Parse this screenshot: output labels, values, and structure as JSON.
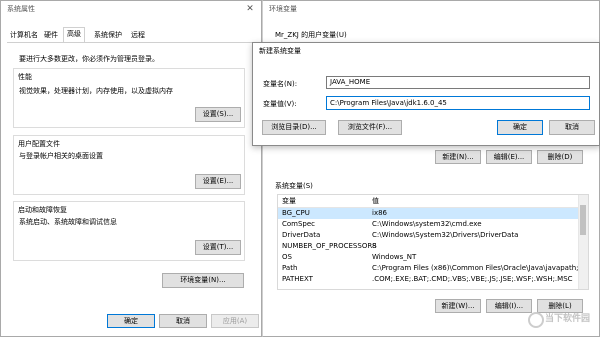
{
  "sysprops": {
    "title": "系统属性",
    "tabs": [
      "计算机名",
      "硬件",
      "高级",
      "系统保护",
      "远程"
    ],
    "admin_note": "要进行大多数更改，你必须作为管理员登录。",
    "performance": {
      "title": "性能",
      "desc": "视觉效果，处理器计划，内存使用，以及虚拟内存",
      "button": "设置(S)..."
    },
    "profiles": {
      "title": "用户配置文件",
      "desc": "与登录帐户相关的桌面设置",
      "button": "设置(E)..."
    },
    "startup": {
      "title": "启动和故障恢复",
      "desc": "系统启动、系统故障和调试信息",
      "button": "设置(T)..."
    },
    "env_button": "环境变量(N)...",
    "ok": "确定",
    "cancel": "取消",
    "apply": "应用(A)"
  },
  "envvars": {
    "title": "环境变量",
    "user_section": "Mr_ZKJ 的用户变量(U)",
    "user_buttons": {
      "new": "新建(N)...",
      "edit": "编辑(E)...",
      "delete": "删除(D)"
    },
    "system_section": "系统变量(S)",
    "col_var": "变量",
    "col_val": "值",
    "system_rows": [
      {
        "name": "BG_CPU",
        "value": "ix86"
      },
      {
        "name": "ComSpec",
        "value": "C:\\Windows\\system32\\cmd.exe"
      },
      {
        "name": "DriverData",
        "value": "C:\\Windows\\System32\\Drivers\\DriverData"
      },
      {
        "name": "NUMBER_OF_PROCESSORS",
        "value": "8"
      },
      {
        "name": "OS",
        "value": "Windows_NT"
      },
      {
        "name": "Path",
        "value": "C:\\Program Files (x86)\\Common Files\\Oracle\\Java\\javapath;C..."
      },
      {
        "name": "PATHEXT",
        "value": ".COM;.EXE;.BAT;.CMD;.VBS;.VBE;.JS;.JSE;.WSF;.WSH;.MSC"
      }
    ],
    "system_buttons": {
      "new": "新建(W)...",
      "edit": "编辑(I)...",
      "delete": "删除(L)"
    }
  },
  "newvar": {
    "title": "新建系统变量",
    "name_label": "变量名(N):",
    "name_value": "JAVA_HOME",
    "value_label": "变量值(V):",
    "value_value": "C:\\Program Files\\Java\\jdk1.6.0_45",
    "browse_dir": "浏览目录(D)...",
    "browse_file": "浏览文件(F)...",
    "ok": "确定",
    "cancel": "取消"
  },
  "watermark": "当下软件园"
}
